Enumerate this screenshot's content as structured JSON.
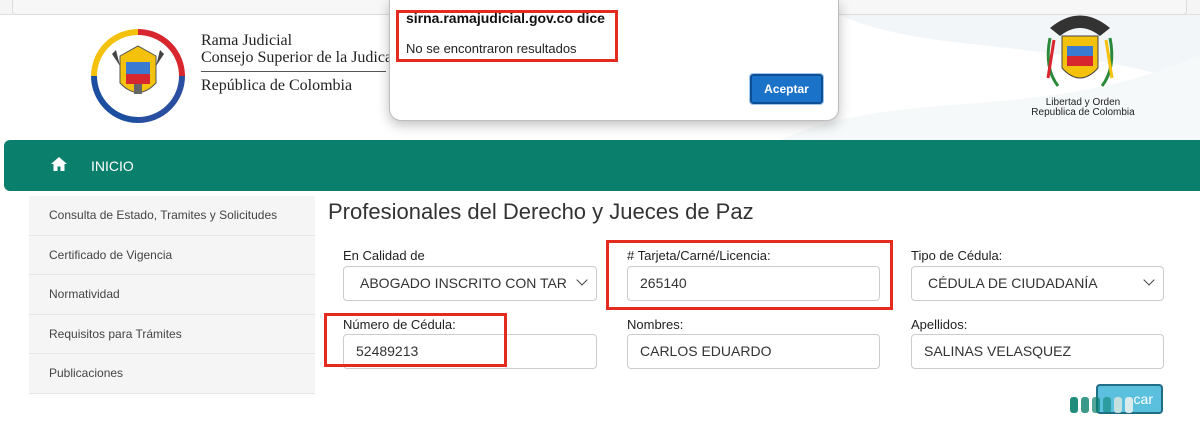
{
  "dialog": {
    "title": "sirna.ramajudicial.gov.co dice",
    "message": "No se encontraron resultados",
    "accept_label": "Aceptar"
  },
  "header": {
    "brand_line1": "Rama Judicial",
    "brand_line2": "Consejo Superior de la Judicatura",
    "brand_line3": "República de Colombia",
    "right_logo_line1": "Libertad y Orden",
    "right_logo_line2": "Republica de Colombia"
  },
  "nav": {
    "home_label": "INICIO"
  },
  "sidebar": {
    "items": [
      {
        "label": "Consulta de Estado, Tramites y Solicitudes"
      },
      {
        "label": "Certificado de Vigencia"
      },
      {
        "label": "Normatividad"
      },
      {
        "label": "Requisitos para Trámites"
      },
      {
        "label": "Publicaciones"
      }
    ]
  },
  "main": {
    "title": "Profesionales del Derecho y Jueces de Paz",
    "form": {
      "calidad_label": "En Calidad de",
      "calidad_value": "ABOGADO INSCRITO CON TAR",
      "tarjeta_label": "# Tarjeta/Carné/Licencia:",
      "tarjeta_value": "265140",
      "tipo_cedula_label": "Tipo de Cédula:",
      "tipo_cedula_value": "CÉDULA DE CIUDADANÍA",
      "numero_cedula_label": "Número de Cédula:",
      "numero_cedula_value": "52489213",
      "nombres_label": "Nombres:",
      "nombres_value": "CARLOS EDUARDO",
      "apellidos_label": "Apellidos:",
      "apellidos_value": "SALINAS VELASQUEZ",
      "buscar_label": "car"
    }
  },
  "colors": {
    "nav_bg": "#0a7f6c",
    "highlight": "#e32c1e",
    "accept_button": "#1a73c9",
    "search_button": "#5bc0de"
  }
}
